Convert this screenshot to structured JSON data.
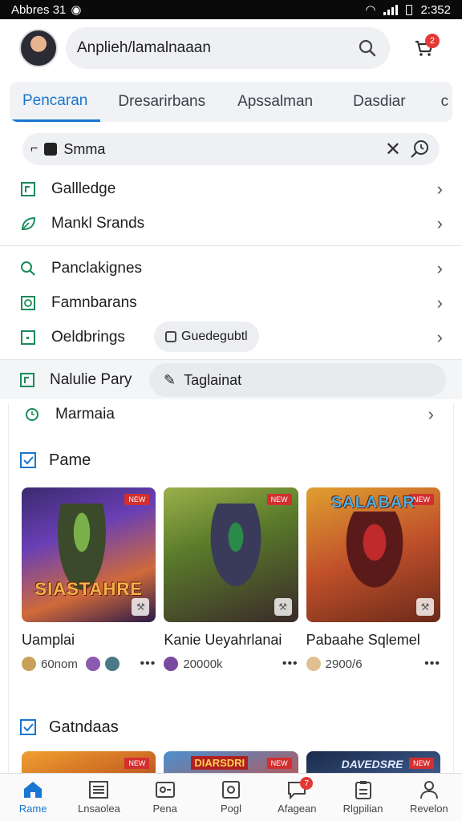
{
  "status_bar": {
    "left": "Abbres 31",
    "time": "2:352"
  },
  "top": {
    "search_text": "Anplieh/lamalnaaan",
    "cart_badge": "2"
  },
  "tabs": [
    {
      "label": "Pencaran",
      "active": true
    },
    {
      "label": "Dresarirbans",
      "active": false
    },
    {
      "label": "Apssalman",
      "active": false
    },
    {
      "label": "Dasdiar",
      "active": false
    },
    {
      "label": "c",
      "active": false
    }
  ],
  "sub_search": {
    "text": "Smma"
  },
  "menu": {
    "group1": [
      {
        "label": "Gallledge"
      },
      {
        "label": "Mankl Srands"
      }
    ],
    "group2": [
      {
        "label": "Panclakignes"
      },
      {
        "label": "Famnbarans"
      },
      {
        "label": "Oeldbrings",
        "pill": "Guedegubtl"
      }
    ],
    "promo": {
      "label": "Nalulie Pary",
      "pill": "Taglainat"
    },
    "partial": {
      "label": "Marmaia"
    }
  },
  "section1": {
    "title": "Pame",
    "games": [
      {
        "name": "Uamplai",
        "tag": "NEW",
        "logo": "SIASTAHRE",
        "meta": "60nom"
      },
      {
        "name": "Kanie Ueyahrlanai",
        "tag": "NEW",
        "logo": "",
        "meta": "20000k"
      },
      {
        "name": "Pabaahe Sqlemel",
        "tag": "NEW",
        "logo": "SALABAR",
        "meta": "2900/6"
      }
    ],
    "more": "•••"
  },
  "section2": {
    "title": "Gatndaas",
    "thumbs": [
      {
        "tag": "NEW"
      },
      {
        "tag": "NEW",
        "logo": "DIARSDRI"
      },
      {
        "tag": "NEW",
        "logo": "DAVEDSRE"
      }
    ]
  },
  "bottom_nav": [
    {
      "label": "Rame",
      "icon": "home-icon",
      "active": true
    },
    {
      "label": "Lnsaolea",
      "icon": "list-icon"
    },
    {
      "label": "Pena",
      "icon": "gamepad-icon"
    },
    {
      "label": "Pogl",
      "icon": "camera-icon"
    },
    {
      "label": "Afagean",
      "icon": "chat-icon",
      "badge": "7"
    },
    {
      "label": "Rlgpilian",
      "icon": "clipboard-icon"
    },
    {
      "label": "Revelon",
      "icon": "profile-icon"
    }
  ]
}
